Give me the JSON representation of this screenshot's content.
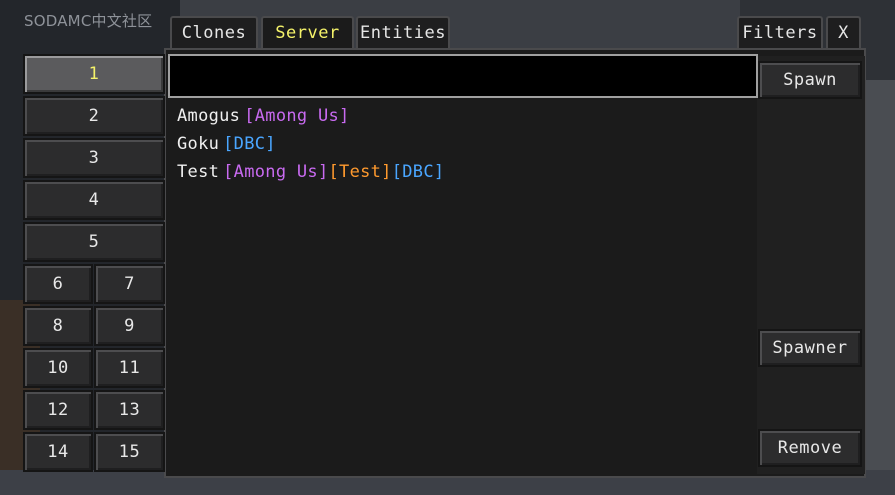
{
  "watermark": "SODAMC中文社区",
  "tabs": [
    {
      "label": "Clones",
      "active": false
    },
    {
      "label": "Server",
      "active": true
    },
    {
      "label": "Entities",
      "active": false
    }
  ],
  "top_right": {
    "filters": "Filters",
    "close": "X"
  },
  "search": {
    "value": "",
    "placeholder": ""
  },
  "actions": {
    "spawn": "Spawn",
    "spawner": "Spawner",
    "remove": "Remove"
  },
  "slots": [
    "1",
    "2",
    "3",
    "4",
    "5",
    "6",
    "7",
    "8",
    "9",
    "10",
    "11",
    "12",
    "13",
    "14",
    "15"
  ],
  "selected_slot": "1",
  "clones": [
    {
      "name": "Amogus",
      "tags": [
        {
          "text": "[Among Us]",
          "color": "#c86af0"
        }
      ]
    },
    {
      "name": "Goku",
      "tags": [
        {
          "text": "[DBC]",
          "color": "#4aa6ff"
        }
      ]
    },
    {
      "name": "Test",
      "tags": [
        {
          "text": "[Among Us]",
          "color": "#c86af0"
        },
        {
          "text": "[Test]",
          "color": "#ff9a2e"
        },
        {
          "text": "[DBC]",
          "color": "#4aa6ff"
        }
      ]
    }
  ],
  "colors": {
    "active_tab": "#f5f36a",
    "panel": "#1b1b1b"
  }
}
